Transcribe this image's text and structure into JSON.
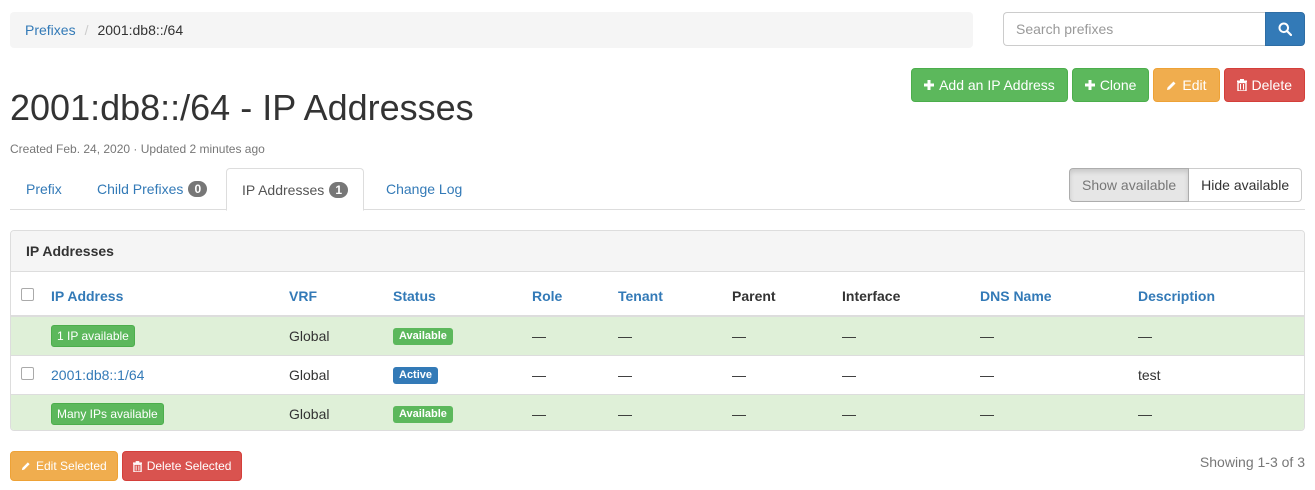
{
  "breadcrumb": {
    "root": "Prefixes",
    "separator": "/",
    "current": "2001:db8::/64"
  },
  "search": {
    "placeholder": "Search prefixes",
    "value": ""
  },
  "actions": {
    "add_ip": "Add an IP Address",
    "clone": "Clone",
    "edit": "Edit",
    "delete": "Delete"
  },
  "page": {
    "title": "2001:db8::/64 - IP Addresses",
    "meta": "Created Feb. 24, 2020 · Updated 2 minutes ago"
  },
  "tabs": [
    {
      "label": "Prefix",
      "badge": ""
    },
    {
      "label": "Child Prefixes",
      "badge": "0"
    },
    {
      "label": "IP Addresses",
      "badge": "1",
      "active": true
    },
    {
      "label": "Change Log",
      "badge": ""
    }
  ],
  "toggle": {
    "show": "Show available",
    "hide": "Hide available"
  },
  "panel": {
    "heading": "IP Addresses",
    "columns": [
      "IP Address",
      "VRF",
      "Status",
      "Role",
      "Tenant",
      "Parent",
      "Interface",
      "DNS Name",
      "Description"
    ],
    "rows": [
      {
        "type": "available",
        "ip": "1 IP available",
        "vrf": "Global",
        "status": "Available",
        "role": "—",
        "tenant": "—",
        "parent": "—",
        "interface": "—",
        "dns": "—",
        "description": "—"
      },
      {
        "type": "ip",
        "ip": "2001:db8::1/64",
        "vrf": "Global",
        "status": "Active",
        "role": "—",
        "tenant": "—",
        "parent": "—",
        "interface": "—",
        "dns": "—",
        "description": "test"
      },
      {
        "type": "available",
        "ip": "Many IPs available",
        "vrf": "Global",
        "status": "Available",
        "role": "—",
        "tenant": "—",
        "parent": "—",
        "interface": "—",
        "dns": "—",
        "description": "—"
      }
    ]
  },
  "bulk": {
    "edit": "Edit Selected",
    "delete": "Delete Selected"
  },
  "pagination": {
    "showing": "Showing 1-3 of 3"
  },
  "colors": {
    "primary": "#337ab7",
    "success": "#5cb85c",
    "warning": "#f0ad4e",
    "danger": "#d9534f",
    "available_row": "#dff0d8"
  },
  "icons": {
    "search": "search-icon",
    "add": "plus-icon",
    "edit": "pencil-icon",
    "delete": "trash-icon"
  }
}
